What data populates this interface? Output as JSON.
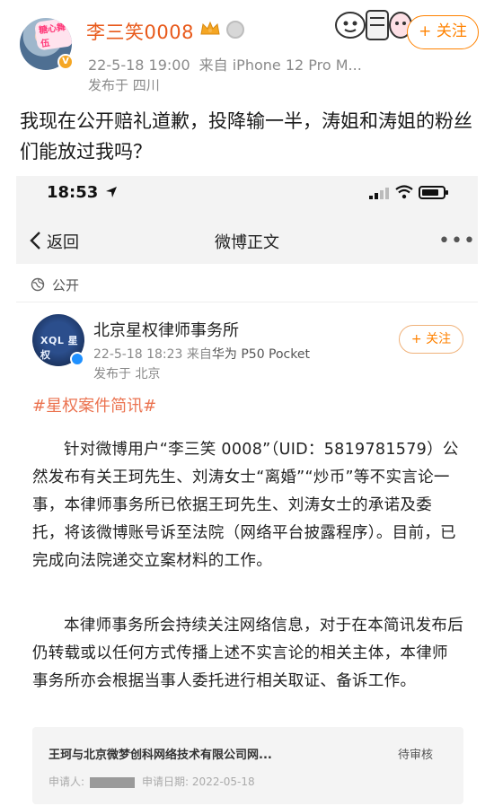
{
  "post": {
    "avatar_sticker": "糖心舞伍",
    "user_name": "李三笑0008",
    "timestamp": "22-5-18 19:00",
    "source": "来自 iPhone 12 Pro M...",
    "location": "发布于 四川",
    "follow_label": "+ 关注",
    "text": "我现在公开赔礼道歉，投降输一半，涛姐和涛姐的粉丝们能放过我吗？"
  },
  "embedded": {
    "status_bar": {
      "time": "18:53"
    },
    "nav": {
      "back_label": "返回",
      "title": "微博正文",
      "more": "•••"
    },
    "visibility": "公开",
    "author": {
      "name": "北京星权律师事务所",
      "avatar_text": "XQL 星权",
      "timestamp": "22-5-18 18:23",
      "source_prefix": "来自",
      "device": "华为 P50 Pocket",
      "location": "发布于 北京",
      "follow_label": "+ 关注"
    },
    "hashtag": "#星权案件简讯#",
    "paragraphs": [
      "针对微博用户“李三笑 0008”（UID：5819781579）公然发布有关王珂先生、刘涛女士“离婚”“炒币”等不实言论一事，本律师事务所已依据王珂先生、刘涛女士的承诺及委托，将该微博账号诉至法院（网络平台披露程序）。目前，已完成向法院递交立案材料的工作。",
      "本律师事务所会持续关注网络信息，对于在本简讯发布后仍转载或以任何方式传播上述不实言论的相关主体，本律师事务所亦会根据当事人委托进行相关取证、备诉工作。"
    ],
    "attachment": {
      "title": "王珂与北京微梦创科网络技术有限公司网...",
      "status": "待审核",
      "applicant_label": "申请人:",
      "date_label": "申请日期:",
      "date": "2022-05-18"
    }
  },
  "colors": {
    "username_orange": "#e8591a",
    "follow_orange": "#ff8200",
    "hashtag": "#eb7350",
    "verified_blue": "#1e90ff"
  }
}
